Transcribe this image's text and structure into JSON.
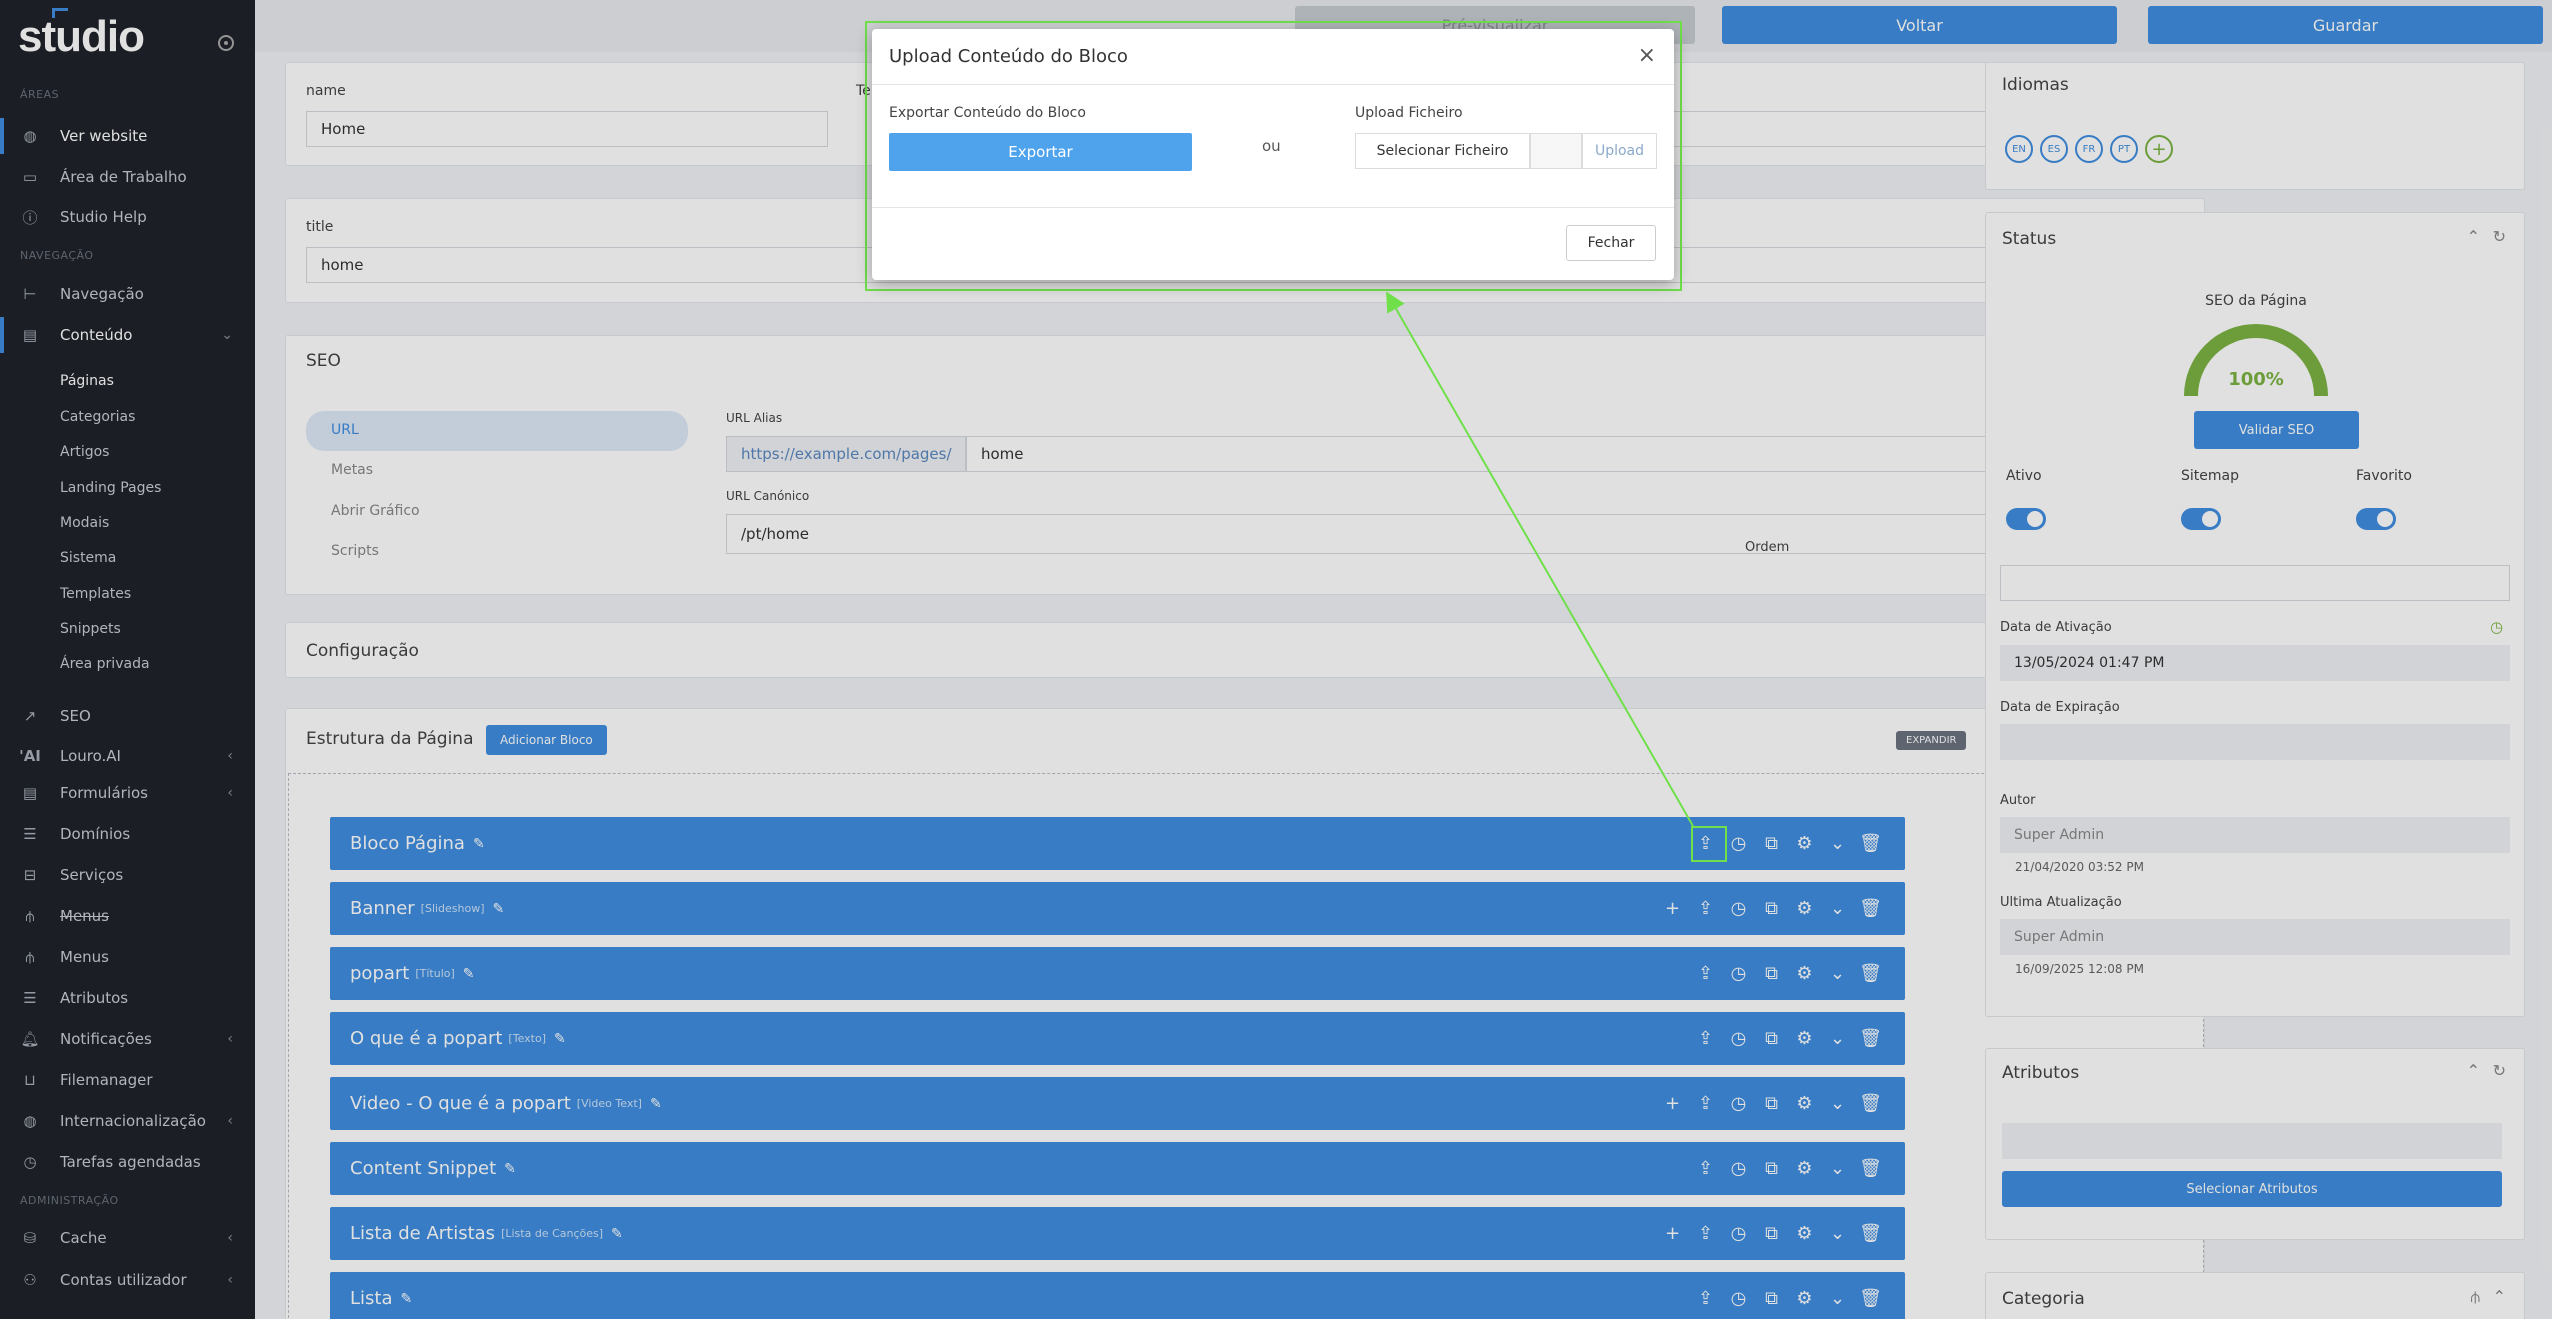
{
  "sidebar": {
    "logo": "studio",
    "sections": {
      "areas": "ÁREAS",
      "navegacao": "NAVEGAÇÃO",
      "administracao": "ADMINISTRAÇÃO"
    },
    "items": [
      {
        "label": "Ver website",
        "icon": "globe-icon"
      },
      {
        "label": "Área de Trabalho",
        "icon": "monitor-icon"
      },
      {
        "label": "Studio Help",
        "icon": "info-icon"
      },
      {
        "label": "Navegação",
        "icon": "tree-icon"
      },
      {
        "label": "Conteúdo",
        "icon": "document-icon"
      },
      {
        "label": "SEO",
        "icon": "chart-line-icon"
      },
      {
        "label": "Louro.AI",
        "icon": "ai-icon"
      },
      {
        "label": "Formulários",
        "icon": "form-icon"
      },
      {
        "label": "Domínios",
        "icon": "list-icon"
      },
      {
        "label": "Serviços",
        "icon": "service-icon"
      },
      {
        "label": "Menus",
        "icon": "sitemap-icon"
      },
      {
        "label": "Menus",
        "icon": "sitemap-icon"
      },
      {
        "label": "Atributos",
        "icon": "list-check-icon"
      },
      {
        "label": "Notificações",
        "icon": "bell-icon"
      },
      {
        "label": "Filemanager",
        "icon": "basket-icon"
      },
      {
        "label": "Internacionalização",
        "icon": "globe-icon"
      },
      {
        "label": "Tarefas agendadas",
        "icon": "clock-icon"
      },
      {
        "label": "Cache",
        "icon": "database-icon"
      },
      {
        "label": "Contas utilizador",
        "icon": "users-icon"
      }
    ],
    "subitems": [
      "Páginas",
      "Categorias",
      "Artigos",
      "Landing Pages",
      "Modais",
      "Sistema",
      "Templates",
      "Snippets",
      "Área privada"
    ]
  },
  "topbar": {
    "preview": "Pré-visualizar",
    "back": "Voltar",
    "save": "Guardar"
  },
  "form": {
    "name_label": "name",
    "name_value": "Home",
    "t_label": "Te",
    "title_label": "title",
    "title_value": "home"
  },
  "seo": {
    "title": "SEO",
    "tabs": [
      "URL",
      "Metas",
      "Abrir Gráfico",
      "Scripts"
    ],
    "alias_label": "URL Alias",
    "alias_prefix": "https://example.com/pages/",
    "alias_value": "home",
    "canonical_label": "URL Canónico",
    "canonical_value": "/pt/home"
  },
  "config": {
    "title": "Configuração"
  },
  "structure": {
    "title": "Estrutura da Página",
    "add_button": "Adicionar Bloco",
    "expand": "EXPANDIR",
    "blocks": [
      {
        "name": "Bloco Página",
        "tag": ""
      },
      {
        "name": "Banner",
        "tag": "[Slideshow]"
      },
      {
        "name": "popart",
        "tag": "[Título]"
      },
      {
        "name": "O que é a popart",
        "tag": "[Texto]"
      },
      {
        "name": "Video - O que é a popart",
        "tag": "[Video Text]"
      },
      {
        "name": "Content Snippet",
        "tag": ""
      },
      {
        "name": "Lista de Artistas",
        "tag": "[Lista de Canções]"
      },
      {
        "name": "Lista",
        "tag": ""
      }
    ]
  },
  "right": {
    "idiomas": "Idiomas",
    "langs": [
      "EN",
      "ES",
      "FR",
      "PT"
    ],
    "status": "Status",
    "seo_page": "SEO da Página",
    "seo_score": "100%",
    "seo_score_value": 100,
    "validate": "Validar SEO",
    "ativo": "Ativo",
    "sitemap": "Sitemap",
    "favorito": "Favorito",
    "ordem": "Ordem",
    "activation_label": "Data de Ativação",
    "activation_value": "13/05/2024 01:47 PM",
    "expiration_label": "Data de Expiração",
    "autor_label": "Autor",
    "autor_value": "Super Admin",
    "autor_date": "21/04/2020 03:52 PM",
    "updated_label": "Ultima Atualização",
    "updated_value": "Super Admin",
    "updated_date": "16/09/2025 12:08 PM",
    "atributos": "Atributos",
    "select_attrs": "Selecionar Atributos",
    "categoria": "Categoria"
  },
  "modal": {
    "title": "Upload Conteúdo do Bloco",
    "close": "×",
    "export_label": "Exportar Conteúdo do Bloco",
    "export_button": "Exportar",
    "or": "ou",
    "upload_label": "Upload Ficheiro",
    "select_file": "Selecionar Ficheiro",
    "upload": "Upload",
    "fechar": "Fechar"
  },
  "colors": {
    "accent": "#3f8ee0",
    "sidebar": "#1f2329",
    "highlight": "#6fe04a",
    "success": "#7cb342"
  }
}
